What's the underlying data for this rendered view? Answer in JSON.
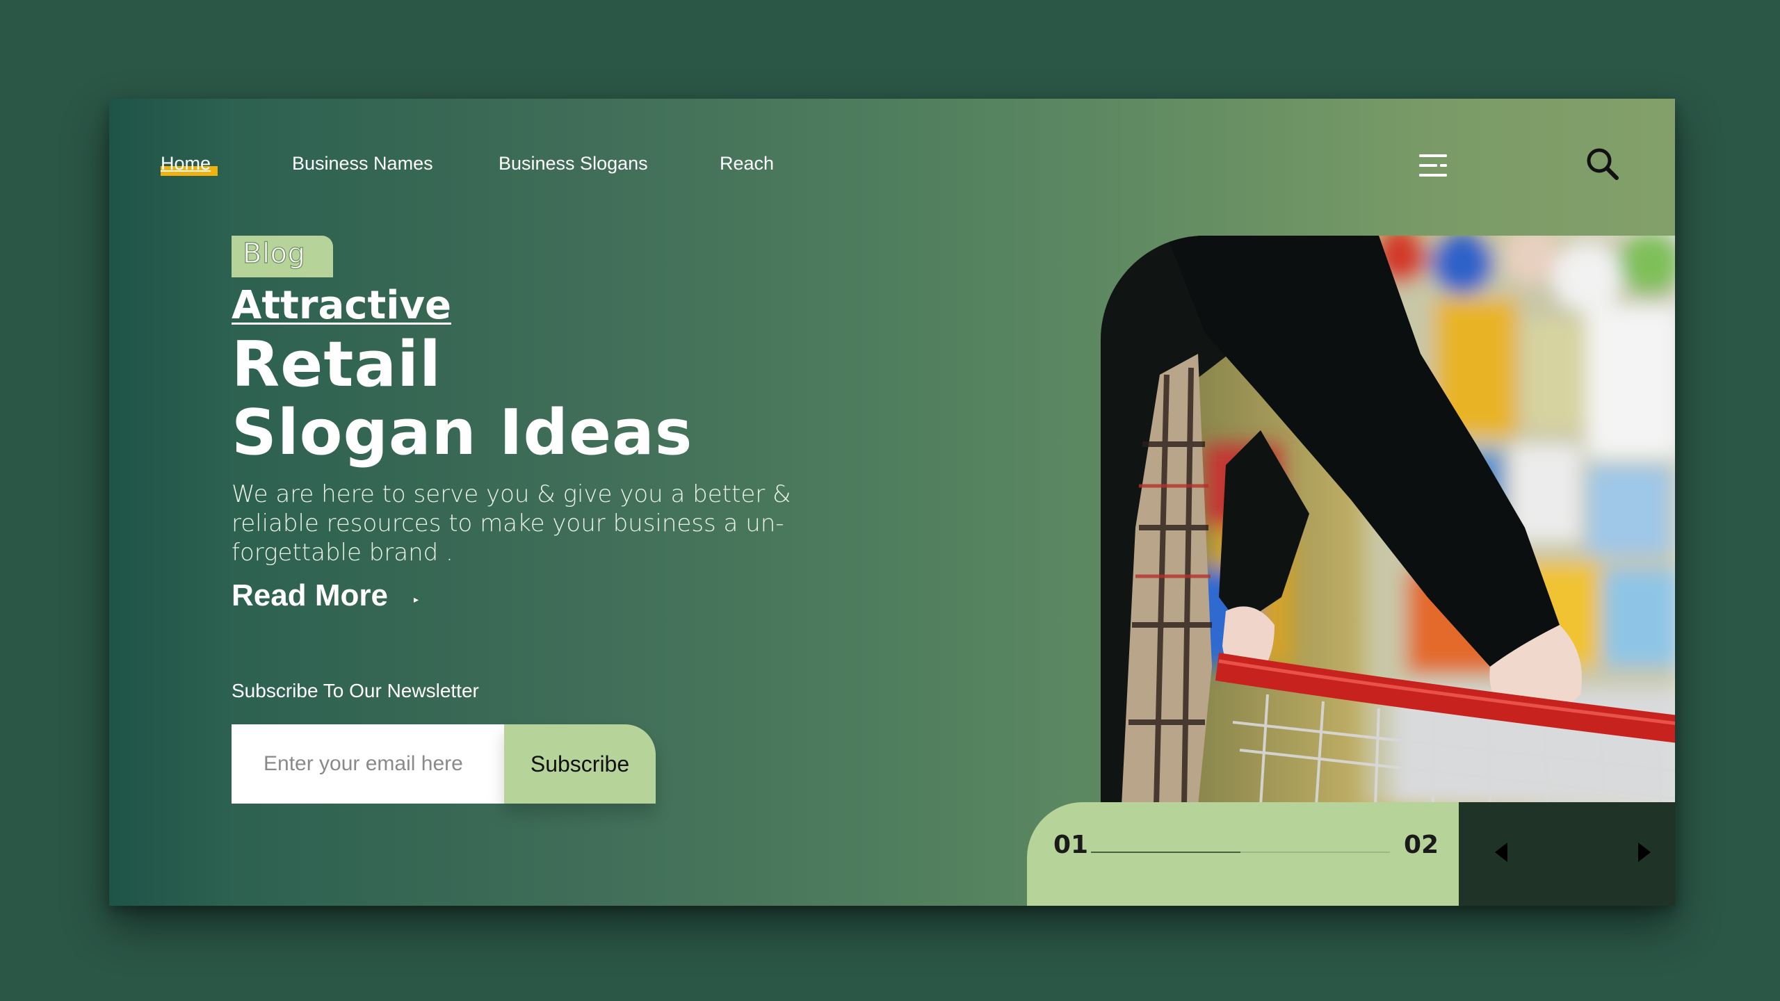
{
  "nav": {
    "items": [
      {
        "label": "Home",
        "active": true
      },
      {
        "label": "Business Names"
      },
      {
        "label": "Business Slogans"
      },
      {
        "label": "Reach"
      }
    ],
    "menu_icon": "hamburger-menu-icon",
    "search_icon": "search-icon"
  },
  "hero": {
    "badge": "Blog",
    "title_line1": "Attractive",
    "title_line2": "Retail",
    "title_line3": "Slogan Ideas",
    "description": "We are here to serve you & give you a better & reliable resources to make your business a un-forgettable brand .",
    "read_more_label": "Read More"
  },
  "newsletter": {
    "label": "Subscribe To Our Newsletter",
    "email_placeholder": "Enter your email here",
    "email_value": "",
    "button_label": "Subscribe"
  },
  "slider": {
    "current": "01",
    "total": "02",
    "progress": 0.5,
    "prev_icon": "triangle-left-icon",
    "next_icon": "triangle-right-icon"
  },
  "colors": {
    "background": "#2b5747",
    "accent_green": "#b6d39a",
    "home_underline": "#f2b10f",
    "controls_bg": "#1f3327"
  }
}
